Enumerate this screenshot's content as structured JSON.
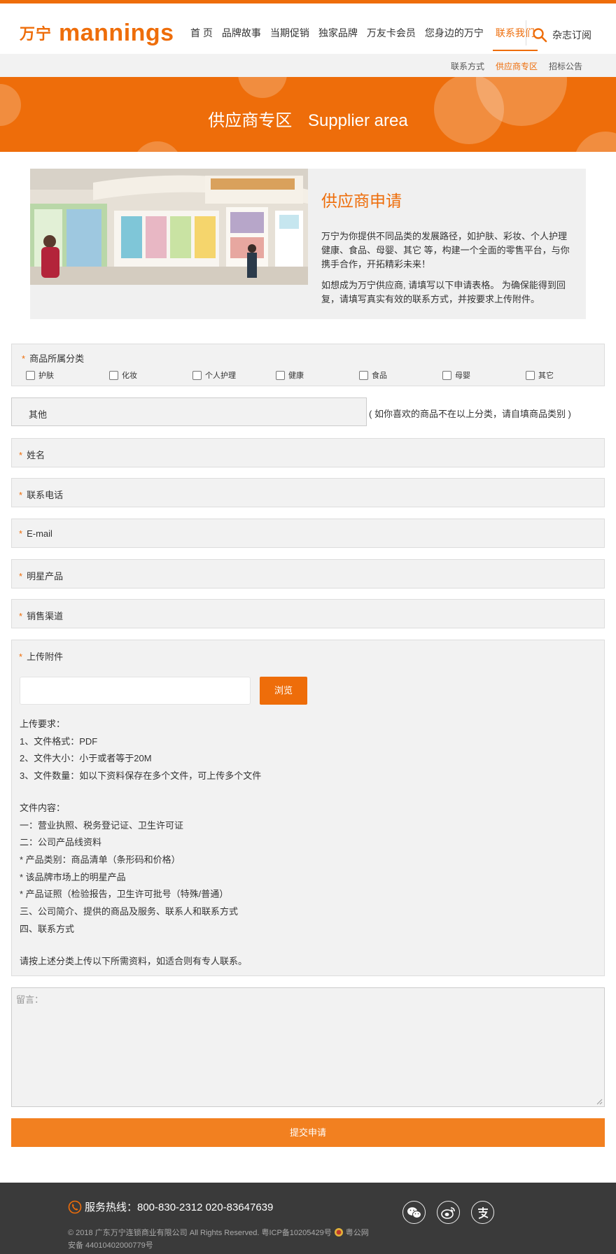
{
  "brand": {
    "cn": "万宁",
    "en": "mannings"
  },
  "nav": {
    "items": [
      "首 页",
      "品牌故事",
      "当期促销",
      "独家品牌",
      "万友卡会员",
      "您身边的万宁",
      "联系我们"
    ],
    "magazine": "杂志订阅"
  },
  "subnav": {
    "items": [
      "联系方式",
      "供应商专区",
      "招标公告"
    ]
  },
  "banner": {
    "title_cn": "供应商专区",
    "title_en": "Supplier area"
  },
  "intro": {
    "title": "供应商申请",
    "p1": "万宁为你提供不同品类的发展路径，如护肤、彩妆、个人护理健康、食品、母婴、其它 等，构建一个全面的零售平台，与你携手合作，开拓精彩未来！",
    "p2": "如想成为万宁供应商, 请填写以下申请表格。 为确保能得到回复，请填写真实有效的联系方式，并按要求上传附件。"
  },
  "form": {
    "required_mark": "*",
    "category_label": "商品所属分类",
    "categories": [
      "护肤",
      "化妆",
      "个人护理",
      "健康",
      "食品",
      "母婴",
      "其它"
    ],
    "other_placeholder": "其他",
    "other_note": "( 如你喜欢的商品不在以上分类，请自填商品类别 )",
    "name_label": "姓名",
    "phone_label": "联系电话",
    "email_label": "E-mail",
    "star_product_label": "明星产品",
    "channel_label": "销售渠道",
    "upload_label": "上传附件",
    "browse_label": "浏览",
    "upload_requirements": [
      "上传要求：",
      "1、文件格式：PDF",
      "2、文件大小：小于或者等于20M",
      "3、文件数量：如以下资料保存在多个文件，可上传多个文件"
    ],
    "file_contents": [
      "文件内容：",
      "一：营业执照、税务登记证、卫生许可证",
      "二：公司产品线资料",
      "* 产品类别：商品清单（条形码和价格）",
      "* 该品牌市场上的明星产品",
      "* 产品证照（检验报告，卫生许可批号（特殊/普通）",
      "三、公司简介、提供的商品及服务、联系人和联系方式",
      "四、联系方式"
    ],
    "closing_note": "请按上述分类上传以下所需资料，如适合则有专人联系。",
    "message_placeholder": "留言：",
    "submit_label": "提交申请"
  },
  "footer": {
    "hotline": "服务热线：800-830-2312 020-83647639",
    "copyright": "© 2018 广东万宁连锁商业有限公司 All Rights Reserved. 粤ICP备10205429号",
    "police": "粤公网",
    "record": "安备 44010402000779号"
  },
  "colors": {
    "accent": "#ee6d0a",
    "footer_bg": "#3a3a3a",
    "form_bg": "#f2f2f2"
  }
}
